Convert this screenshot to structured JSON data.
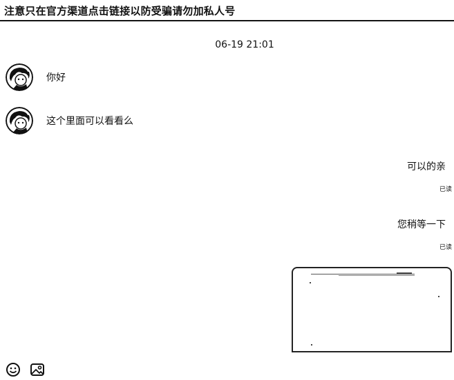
{
  "header": {
    "title": "注意只在官方渠道点击链接以防受骗请勿加私人号"
  },
  "chat": {
    "timestamp": "06-19 21:01",
    "messages": [
      {
        "direction": "incoming",
        "text": "你好"
      },
      {
        "direction": "incoming",
        "text": "这个里面可以看看么"
      },
      {
        "direction": "outgoing",
        "text": "可以的亲",
        "status": "已读"
      },
      {
        "direction": "outgoing",
        "text": "您稍等一下",
        "status": "已读"
      }
    ]
  },
  "toolbar": {
    "icons": [
      "emoji-icon",
      "image-upload-icon"
    ]
  },
  "colors": {
    "text": "#111111",
    "background": "#ffffff",
    "border": "#111111"
  }
}
